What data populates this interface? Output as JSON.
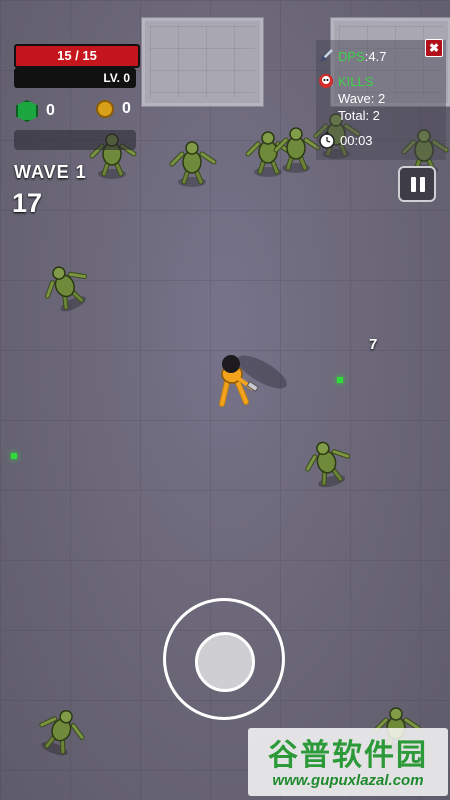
{
  "hud": {
    "hp_text": "15 / 15",
    "level_text": "LV. 0",
    "gems": "0",
    "coins": "0",
    "wave_label": "WAVE 1",
    "enemy_count": "17"
  },
  "stats_panel": {
    "dps_key": "DPS",
    "dps_value": ":4.7",
    "kills_key": "KILLS",
    "kills_wave": "Wave: 2",
    "kills_total": "Total: 2",
    "timer": "00:03",
    "close_label": "✖"
  },
  "floating_damage": "7",
  "icons": {
    "gem": "gem-icon",
    "coin": "coin-icon",
    "sword": "sword-icon",
    "skull": "skull-icon",
    "stopwatch": "stopwatch-icon",
    "pause": "pause-icon"
  },
  "watermark": {
    "title": "谷普软件园",
    "url": "www.gupuxlazal.com"
  },
  "colors": {
    "hp_red": "#c4161c",
    "stat_green": "#3fd04a",
    "zombie_green": "#6f8a3a",
    "player_yellow": "#f2a21c"
  }
}
